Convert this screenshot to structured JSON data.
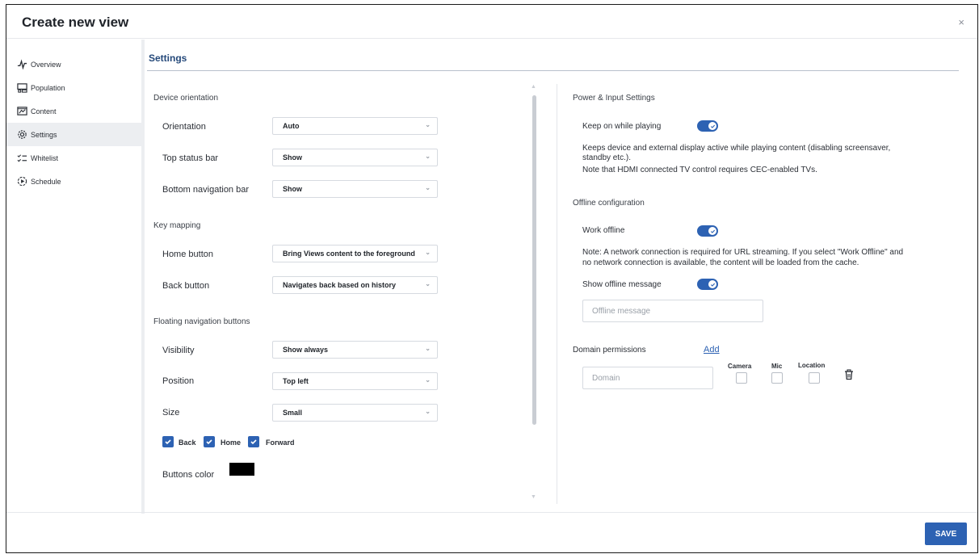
{
  "dialog": {
    "title": "Create new view",
    "close": "×"
  },
  "sidebar": {
    "items": [
      {
        "label": "Overview",
        "icon": "pulse-icon"
      },
      {
        "label": "Population",
        "icon": "devices-icon"
      },
      {
        "label": "Content",
        "icon": "content-icon"
      },
      {
        "label": "Settings",
        "icon": "gear-icon",
        "active": true
      },
      {
        "label": "Whitelist",
        "icon": "checklist-icon"
      },
      {
        "label": "Schedule",
        "icon": "schedule-icon"
      }
    ]
  },
  "main": {
    "title": "Settings",
    "device_orientation": {
      "heading": "Device orientation",
      "orientation": {
        "label": "Orientation",
        "value": "Auto"
      },
      "top_status_bar": {
        "label": "Top status bar",
        "value": "Show"
      },
      "bottom_nav_bar": {
        "label": "Bottom navigation bar",
        "value": "Show"
      }
    },
    "key_mapping": {
      "heading": "Key mapping",
      "home_button": {
        "label": "Home button",
        "value": "Bring Views content to the foreground"
      },
      "back_button": {
        "label": "Back button",
        "value": "Navigates back based on history"
      }
    },
    "floating_nav": {
      "heading": "Floating navigation buttons",
      "visibility": {
        "label": "Visibility",
        "value": "Show always"
      },
      "position": {
        "label": "Position",
        "value": "Top left"
      },
      "size": {
        "label": "Size",
        "value": "Small"
      },
      "checkboxes": {
        "back": "Back",
        "home": "Home",
        "forward": "Forward"
      },
      "buttons_color": {
        "label": "Buttons color",
        "value": "#000000"
      }
    },
    "power_input": {
      "heading": "Power & Input Settings",
      "keep_on": {
        "label": "Keep on while playing",
        "enabled": true
      },
      "description_line1": "Keeps device and external display active while playing content (disabling screensaver,",
      "description_line2": "standby etc.).",
      "description_line3": "Note that HDMI connected TV control requires CEC-enabled TVs."
    },
    "offline": {
      "heading": "Offline configuration",
      "work_offline": {
        "label": "Work offline",
        "enabled": true
      },
      "note_line1": "Note: A network connection is required for URL streaming. If you select \"Work Offline\" and",
      "note_line2": "no network connection is available, the content will be loaded from the cache.",
      "show_message": {
        "label": "Show offline message",
        "enabled": true
      },
      "message_placeholder": "Offline message"
    },
    "domain_permissions": {
      "heading": "Domain permissions",
      "add_link": "Add",
      "domain_placeholder": "Domain",
      "columns": {
        "camera": "Camera",
        "mic": "Mic",
        "location": "Location"
      }
    }
  },
  "footer": {
    "save_label": "SAVE"
  },
  "colors": {
    "accent": "#2d62b3",
    "title": "#25497a",
    "active_bg": "#eceef1"
  }
}
